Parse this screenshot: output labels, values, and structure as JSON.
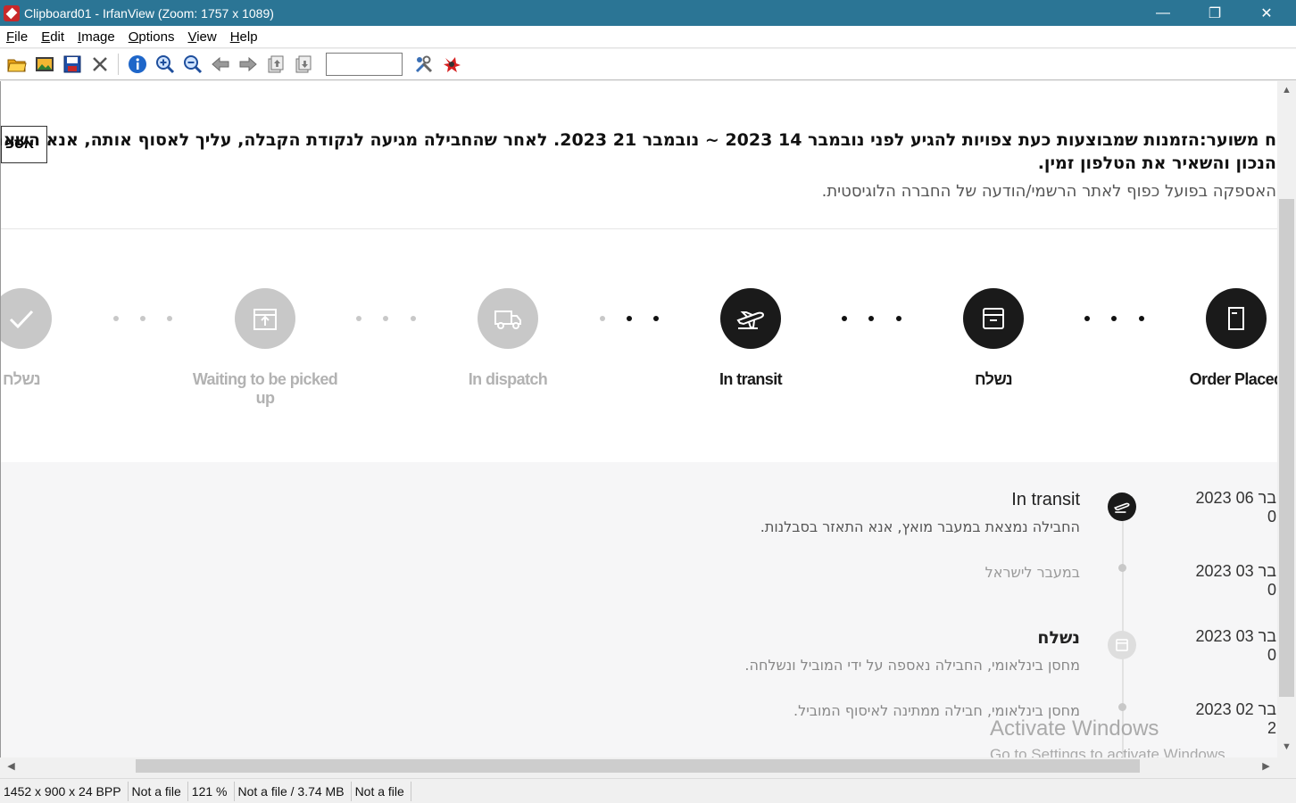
{
  "window": {
    "title": "Clipboard01 - IrfanView (Zoom: 1757 x 1089)",
    "minimize": "—",
    "maximize": "❐",
    "close": "✕"
  },
  "menu": [
    "File",
    "Edit",
    "Image",
    "Options",
    "View",
    "Help"
  ],
  "toolbar": {
    "icons": [
      "open-folder-icon",
      "slideshow-icon",
      "save-icon",
      "delete-icon",
      "info-icon",
      "zoom-in-icon",
      "zoom-out-icon",
      "previous-icon",
      "next-icon",
      "page-up-icon",
      "page-down-icon",
      "settings-icon",
      "irfanview-logo-icon"
    ],
    "page_value": ""
  },
  "notice": {
    "button": "אספ",
    "line1": "ח משוער:הזמנות שמבוצעות כעת צפויות להגיע לפני נובמבר 14 2023 ~ נובמבר 21 2023. לאחר שהחבילה מגיעה לנקודת הקבלה, עליך לאסוף אותה, אנא השאר את מספר",
    "line2": "הנכון והשאיר את הטלפון זמין.",
    "line3": "האספקה בפועל כפוף לאתר הרשמי/הודעה של החברה הלוגיסטית."
  },
  "steps": [
    {
      "label": "נשלח",
      "state": "off",
      "icon": "check-icon"
    },
    {
      "label": "Waiting to be picked up",
      "state": "off",
      "icon": "package-icon"
    },
    {
      "label": "In dispatch",
      "state": "off",
      "icon": "truck-icon"
    },
    {
      "label": "In transit",
      "state": "on",
      "icon": "airplane-icon"
    },
    {
      "label": "נשלח",
      "state": "on",
      "icon": "box-icon"
    },
    {
      "label": "Order Placed",
      "state": "on",
      "icon": "document-icon"
    }
  ],
  "timeline": [
    {
      "date": "2023 06 בר",
      "time": "0",
      "title": "In transit",
      "desc": "החבילה נמצאת במעבר מואץ, אנא התאזר בסבלנות."
    },
    {
      "date": "2023 03 בר",
      "time": "0",
      "title": "במעבר לישראל",
      "desc": ""
    },
    {
      "date": "2023 03 בר",
      "time": "0",
      "title": "נשלח",
      "desc": "מחסן בינלאומי, החבילה נאספה על ידי המוביל ונשלחה."
    },
    {
      "date": "2023 02 בר",
      "time": "2",
      "title": "",
      "desc": "מחסן בינלאומי, חבילה ממתינה לאיסוף המוביל."
    }
  ],
  "watermark": {
    "line1": "Activate Windows",
    "line2": "Go to Settings to activate Windows."
  },
  "status": [
    "1452 x 900 x 24 BPP",
    "Not a file",
    "121 %",
    "Not a file / 3.74 MB",
    "Not a file"
  ],
  "colors": {
    "titlebar": "#2b7595",
    "step_active": "#1a1a1a",
    "step_inactive": "#c8c8c8"
  }
}
